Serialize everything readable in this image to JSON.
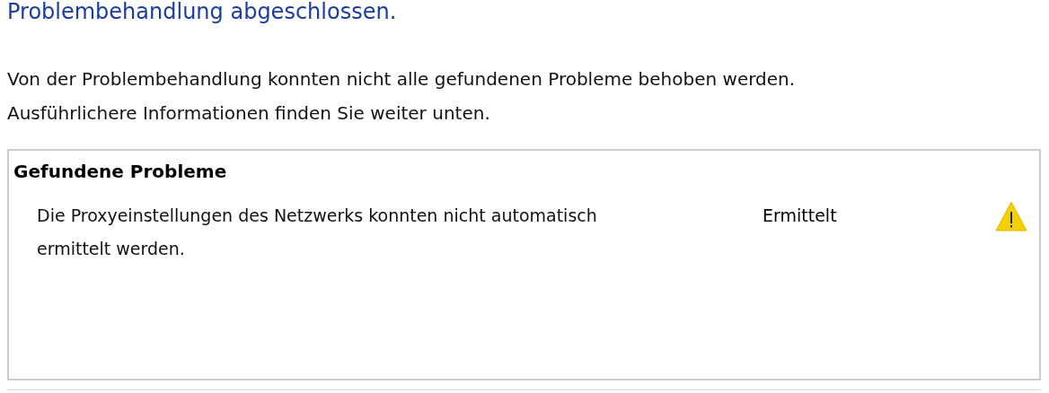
{
  "heading": "Problembehandlung abgeschlossen.",
  "description": [
    "Von der Problembehandlung konnten nicht alle gefundenen Probleme behoben werden.",
    "Ausführlichere Informationen finden Sie weiter unten."
  ],
  "problems": {
    "title": "Gefundene Probleme",
    "items": [
      {
        "text": "Die Proxyeinstellungen des Netzwerks konnten nicht automatisch ermittelt werden.",
        "status": "Ermittelt",
        "kind": "warning"
      }
    ]
  }
}
